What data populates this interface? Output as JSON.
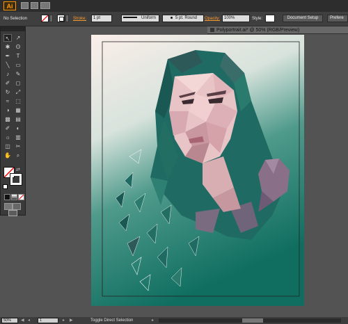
{
  "app": {
    "logo": "Ai"
  },
  "control_bar": {
    "selection_label": "No Selection",
    "stroke_label": "Stroke:",
    "stroke_value": "1 pt",
    "profile_value": "Uniform",
    "brush_value": "5 pt. Round",
    "opacity_label": "Opacity:",
    "opacity_value": "100%",
    "style_label": "Style:",
    "document_setup_label": "Document Setup",
    "preferences_label": "Prefere"
  },
  "document": {
    "tab_title": "Polyportrait.ai* @ 50% (RGB/Preview)",
    "background_colors": [
      "#f8e8e6",
      "#1f7a6b"
    ],
    "accent": "#ff9a2e"
  },
  "status_bar": {
    "zoom": "50%",
    "page": "1",
    "message": "Toggle Direct Selection"
  },
  "tools": [
    "selection-tool",
    "direct-selection-tool",
    "magic-wand-tool",
    "lasso-tool",
    "pen-tool",
    "type-tool",
    "line-tool",
    "rectangle-tool",
    "paintbrush-tool",
    "pencil-tool",
    "blob-brush-tool",
    "eraser-tool",
    "rotate-tool",
    "scale-tool",
    "width-tool",
    "free-transform-tool",
    "shape-builder-tool",
    "perspective-grid-tool",
    "mesh-tool",
    "gradient-tool",
    "eyedropper-tool",
    "blend-tool",
    "symbol-sprayer-tool",
    "column-graph-tool",
    "artboard-tool",
    "slice-tool",
    "hand-tool",
    "zoom-tool"
  ],
  "tool_glyphs": [
    "↖",
    "↗",
    "✱",
    "ʘ",
    "✒",
    "T",
    "╲",
    "▭",
    "♪",
    "✎",
    "✐",
    "◻",
    "↻",
    "⤢",
    "≈",
    "⬚",
    "◑",
    "▦",
    "▩",
    "▤",
    "✐",
    "◐",
    "☼",
    "▥",
    "◫",
    "✂",
    "✋",
    "⌕"
  ]
}
